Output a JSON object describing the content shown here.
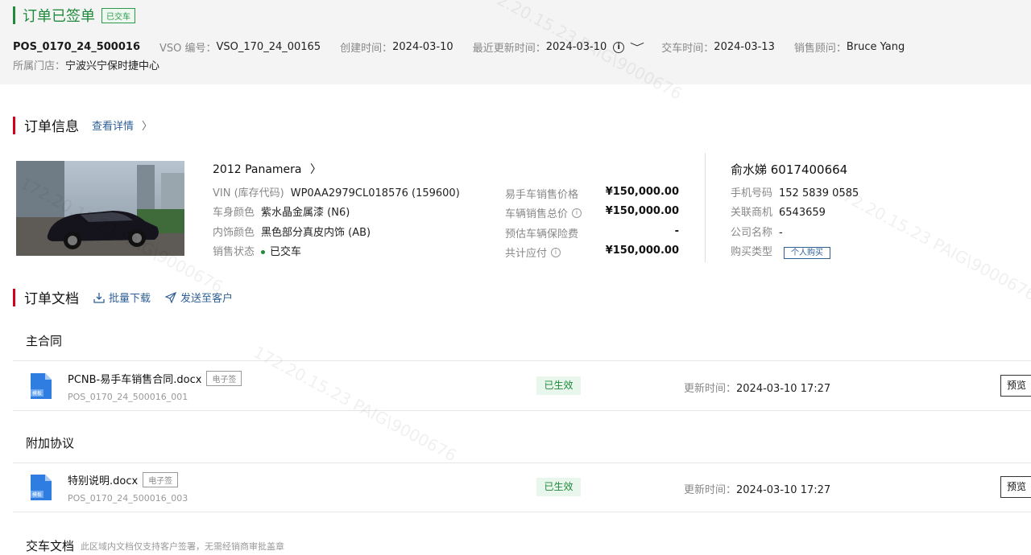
{
  "header": {
    "title": "订单已签单",
    "status_tag": "已交车",
    "pos_no": "POS_0170_24_500016",
    "vso_label": "VSO 编号：",
    "vso_value": "VSO_170_24_00165",
    "created_label": "创建时间：",
    "created_value": "2024-03-10",
    "updated_label": "最近更新时间：",
    "updated_value": "2024-03-10",
    "delivery_label": "交车时间：",
    "delivery_value": "2024-03-13",
    "consultant_label": "销售顾问：",
    "consultant_value": "Bruce Yang",
    "store_label": "所属门店：",
    "store_value": "宁波兴宁保时捷中心"
  },
  "order_info": {
    "title": "订单信息",
    "details_link": "查看详情",
    "car_name": "2012 Panamera",
    "vin_label": "VIN (库存代码)",
    "vin_value": "WP0AA2979CL018576 (159600)",
    "color_label": "车身颜色",
    "color_value": "紫水晶金属漆 (N6)",
    "interior_label": "内饰颜色",
    "interior_value": "黑色部分真皮内饰 (AB)",
    "status_label": "销售状态",
    "status_value": "已交车",
    "prices": [
      {
        "label": "易手车销售价格",
        "value": "¥150,000.00",
        "info": false
      },
      {
        "label": "车辆销售总价",
        "value": "¥150,000.00",
        "info": true
      },
      {
        "label": "预估车辆保险费",
        "value": "-",
        "info": false
      },
      {
        "label": "共计应付",
        "value": "¥150,000.00",
        "info": true
      }
    ],
    "customer_name": "俞水娣 6017400664",
    "phone_label": "手机号码",
    "phone_value": "152 5839 0585",
    "dealer_label": "关联商机",
    "dealer_value": "6543659",
    "company_label": "公司名称",
    "company_value": "-",
    "buy_type_label": "购买类型",
    "buy_type_value": "个人购买"
  },
  "documents": {
    "title": "订单文档",
    "batch_download": "批量下载",
    "send_to_customer": "发送至客户",
    "main_contract_title": "主合同",
    "addendum_title": "附加协议",
    "delivery_docs_title": "交车文档",
    "delivery_docs_hint": "此区域内文档仅支持客户签署，无需经销商审批盖章",
    "items": [
      {
        "name": "PCNB-易手车销售合同.docx",
        "tag": "电子签",
        "code": "POS_0170_24_500016_001",
        "status": "已生效",
        "updated_label": "更新时间：",
        "updated_value": "2024-03-10 17:27",
        "preview": "预览",
        "icon_label": "模板"
      },
      {
        "name": "特别说明.docx",
        "tag": "电子签",
        "code": "POS_0170_24_500016_003",
        "status": "已生效",
        "updated_label": "更新时间：",
        "updated_value": "2024-03-10 17:27",
        "preview": "预览",
        "icon_label": "模板"
      }
    ]
  },
  "watermark": "172.20.15.23 PAIG\\9000676",
  "colors": {
    "accent_green": "#1f8a3c",
    "accent_red": "#d5001c",
    "link_blue": "#2e5f95"
  },
  "icons": [
    "info-icon",
    "chevron-down-icon",
    "chevron-right-icon",
    "download-icon",
    "send-icon",
    "doc-file-icon"
  ]
}
